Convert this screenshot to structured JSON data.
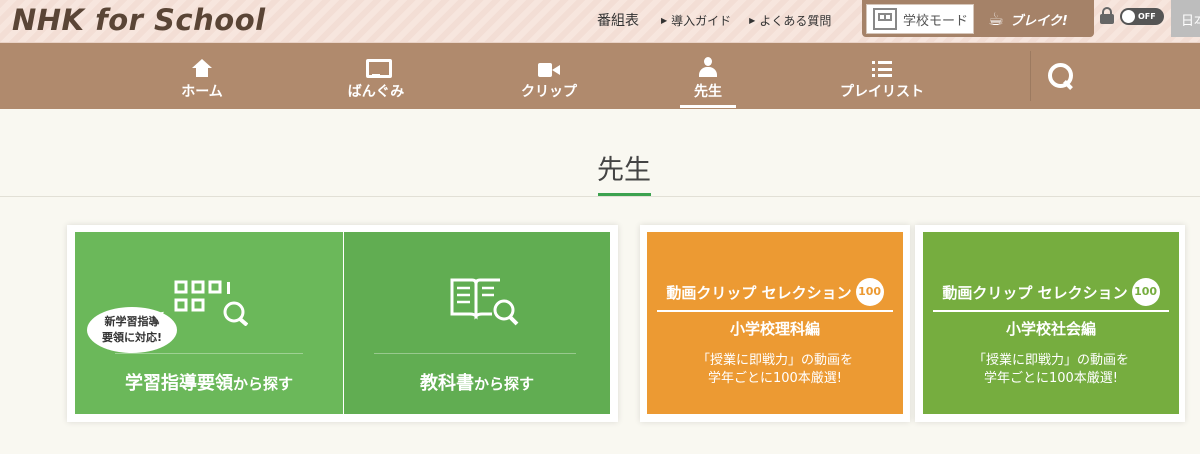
{
  "brand": {
    "logo": "NHK for School"
  },
  "toplinks": {
    "schedule": "番組表",
    "guide": "導入ガイド",
    "faq": "よくある質問"
  },
  "mode": {
    "school_mode": "学校モード",
    "breaker": "ブレイク!",
    "toggle_state": "OFF",
    "language": "日本"
  },
  "nav": {
    "items": [
      {
        "label": "ホーム",
        "icon": "home-icon"
      },
      {
        "label": "ばんぐみ",
        "icon": "tv-icon"
      },
      {
        "label": "クリップ",
        "icon": "video-icon"
      },
      {
        "label": "先生",
        "icon": "teacher-icon",
        "active": true
      },
      {
        "label": "プレイリスト",
        "icon": "list-icon"
      }
    ],
    "search_icon": "search-icon"
  },
  "page": {
    "title": "先生"
  },
  "cards": {
    "guideline": {
      "bubble_line1": "新学習指導",
      "bubble_line2": "要領に対応!",
      "label_main": "学習指導要領",
      "label_suffix": "から探す"
    },
    "textbook": {
      "label_main": "教科書",
      "label_suffix": "から探す"
    },
    "science": {
      "heading": "動画クリップ セレクション",
      "badge": "100",
      "subtitle": "小学校理科編",
      "desc_line1": "「授業に即戦力」の動画を",
      "desc_line2": "学年ごとに100本厳選!"
    },
    "social": {
      "heading": "動画クリップ セレクション",
      "badge": "100",
      "subtitle": "小学校社会編",
      "desc_line1": "「授業に即戦力」の動画を",
      "desc_line2": "学年ごとに100本厳選!"
    }
  },
  "colors": {
    "nav_bg": "#b08a6d",
    "accent_green": "#3ca24f",
    "tile_green": "#6bb85a",
    "tile_orange": "#ec9a33",
    "tile_olive": "#76ad3f"
  }
}
